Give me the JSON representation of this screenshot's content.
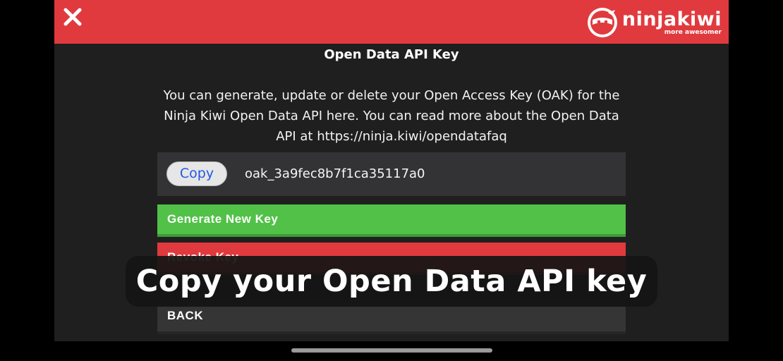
{
  "header": {
    "close_icon": "close-icon",
    "logo": {
      "word": "ninjakiwi",
      "tagline": "more awesomer"
    },
    "accent_color": "#e03a3e"
  },
  "panel": {
    "title": "Open Data API Key",
    "description": "You can generate, update or delete your Open Access Key (OAK) for the Ninja Kiwi Open Data API here. You can read more about the Open Data API at https://ninja.kiwi/opendatafaq",
    "key_row": {
      "copy_label": "Copy",
      "key_value": "oak_3a9fec8b7f1ca35117a0"
    },
    "buttons": {
      "generate_label": "Generate New Key",
      "revoke_label": "Revoke Key",
      "back_label": "BACK"
    }
  },
  "caption": "Copy your Open Data API key",
  "colors": {
    "generate": "#52c148",
    "revoke": "#e03a3e",
    "background": "#1f1f1f"
  }
}
